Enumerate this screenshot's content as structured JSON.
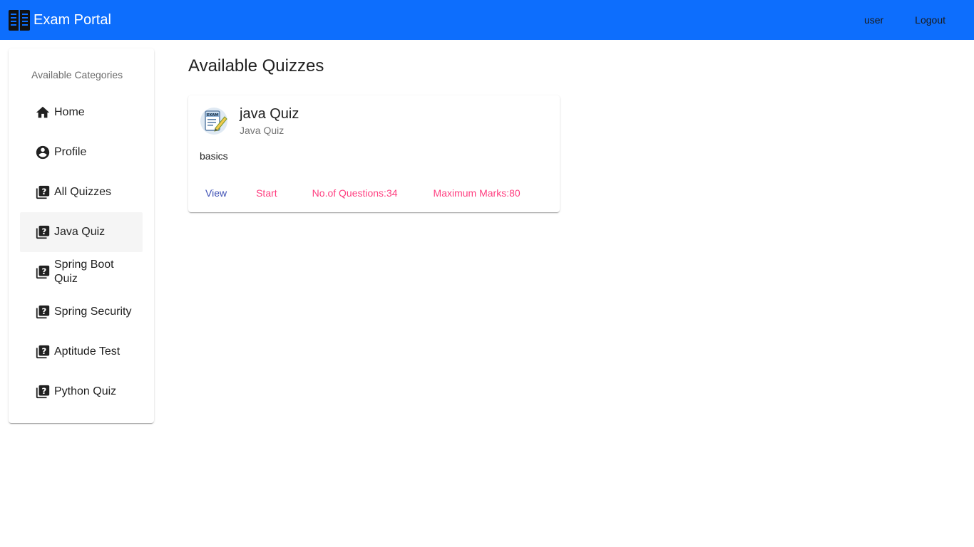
{
  "header": {
    "brand_title": "Exam Portal",
    "user_label": "user",
    "logout_label": "Logout",
    "bar_color": "#0d6efd",
    "brand_icon": "book-icon"
  },
  "sidebar": {
    "header": "Available Categories",
    "items": [
      {
        "label": "Home",
        "icon": "home-icon"
      },
      {
        "label": "Profile",
        "icon": "account-circle-icon"
      },
      {
        "label": "All Quizzes",
        "icon": "quiz-icon"
      },
      {
        "label": "Java Quiz",
        "icon": "quiz-icon",
        "active": true
      },
      {
        "label": "Spring Boot Quiz",
        "icon": "quiz-icon"
      },
      {
        "label": "Spring Security",
        "icon": "quiz-icon"
      },
      {
        "label": "Aptitude Test",
        "icon": "quiz-icon"
      },
      {
        "label": "Python Quiz",
        "icon": "quiz-icon"
      }
    ]
  },
  "main": {
    "title": "Available Quizzes",
    "quizzes": [
      {
        "title": "java Quiz",
        "subtitle": "Java Quiz",
        "description": "basics",
        "avatar_icon": "exam-sheet-icon",
        "view_label": "View",
        "start_label": "Start",
        "questions_label": "No.of Questions:34",
        "marks_label": "Maximum Marks:80"
      }
    ]
  },
  "colors": {
    "accent_pink": "#ff4081",
    "primary_indigo": "#3f51b5"
  }
}
